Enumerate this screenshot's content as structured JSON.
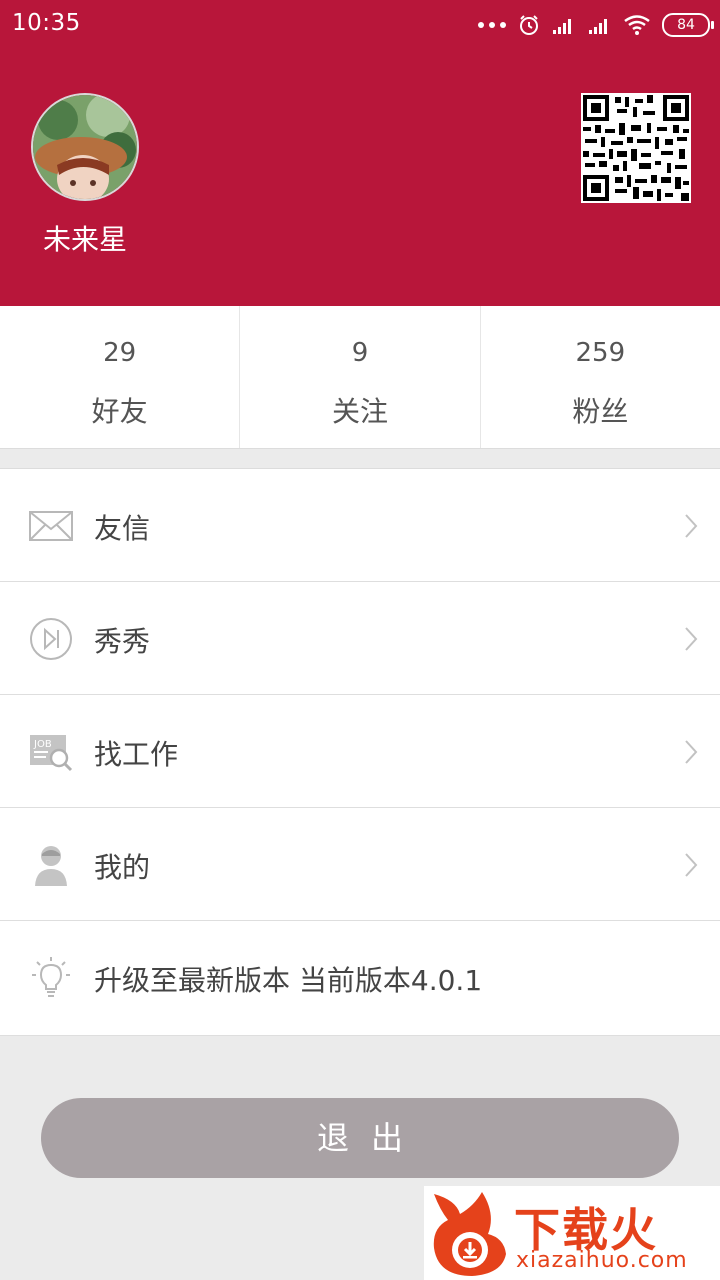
{
  "status_bar": {
    "time": "10:35",
    "battery": "84",
    "icons": [
      "more-dots-icon",
      "alarm-icon",
      "signal-icon",
      "signal-icon",
      "wifi-icon",
      "battery-icon"
    ]
  },
  "profile": {
    "username": "未来星",
    "avatar": "avatar-photo",
    "qr_icon": "qr-code-icon"
  },
  "stats": [
    {
      "value": "29",
      "label": "好友"
    },
    {
      "value": "9",
      "label": "关注"
    },
    {
      "value": "259",
      "label": "粉丝"
    }
  ],
  "menu": [
    {
      "label": "友信",
      "icon": "envelope-icon",
      "has_chevron": true
    },
    {
      "label": "秀秀",
      "icon": "play-next-icon",
      "has_chevron": true
    },
    {
      "label": "找工作",
      "icon": "job-search-icon",
      "has_chevron": true
    },
    {
      "label": "我的",
      "icon": "user-icon",
      "has_chevron": true
    },
    {
      "label": "升级至最新版本 当前版本4.0.1",
      "icon": "lightbulb-icon",
      "has_chevron": false
    }
  ],
  "logout_label": "退出",
  "watermark": {
    "title": "下载火",
    "url": "xiazaihuo.com"
  },
  "colors": {
    "header": "#b8163a",
    "logout_button": "#a9a2a5",
    "watermark": "#e5421b"
  }
}
